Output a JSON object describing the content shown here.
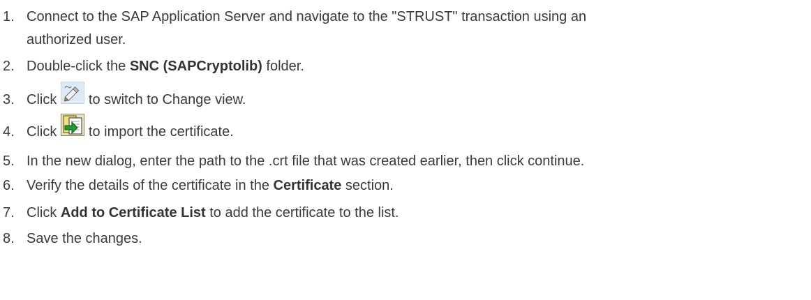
{
  "steps": [
    {
      "number": "1.",
      "line1": "Connect to the SAP Application Server and navigate to the \"STRUST\" transaction using an",
      "line2": "authorized user."
    },
    {
      "number": "2.",
      "pre": "Double-click the ",
      "bold": "SNC (SAPCryptolib)",
      "post": " folder."
    },
    {
      "number": "3.",
      "pre": "Click ",
      "icon": "pencil-edit-icon",
      "post": "to switch to Change view."
    },
    {
      "number": "4.",
      "pre": "Click ",
      "icon": "import-certificate-icon",
      "post": "to import the certificate."
    },
    {
      "number": "5.",
      "text": "In the new dialog, enter the path to the .crt file that was created earlier, then click continue."
    },
    {
      "number": "6.",
      "pre": "Verify the details of the certificate in the ",
      "bold": "Certificate",
      "post": " section."
    },
    {
      "number": "7.",
      "pre": "Click ",
      "bold": "Add to Certificate List",
      "post": " to add the certificate to the list."
    },
    {
      "number": "8.",
      "text": "Save the changes."
    }
  ]
}
